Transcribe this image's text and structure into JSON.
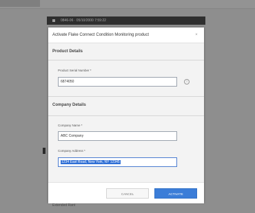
{
  "background": {
    "topbar_left_text": "",
    "topbar_right_text": "",
    "strip_text": "0846-06 · 05/10/2000 7:59:22",
    "bottom_text": "Extended Rant"
  },
  "modal": {
    "title": "Activate Flake Connect Condition Monitoring product",
    "close_symbol": "×",
    "product_section": {
      "title": "Product Details",
      "serial_label": "Product Serial Number *",
      "serial_value": "6874050",
      "info_symbol": "i"
    },
    "company_section": {
      "title": "Company Details",
      "name_label": "Company Name *",
      "name_value": "ABC Company",
      "address_label": "Company Address *",
      "address_value": "1234 East Road, New York, NY 12345"
    },
    "footer": {
      "cancel_label": "CANCEL",
      "activate_label": "ACTIVATE"
    }
  },
  "colors": {
    "overlay": "#8e8e8e",
    "primary_button": "#3b7dd8",
    "selection": "#2f6fd6"
  }
}
